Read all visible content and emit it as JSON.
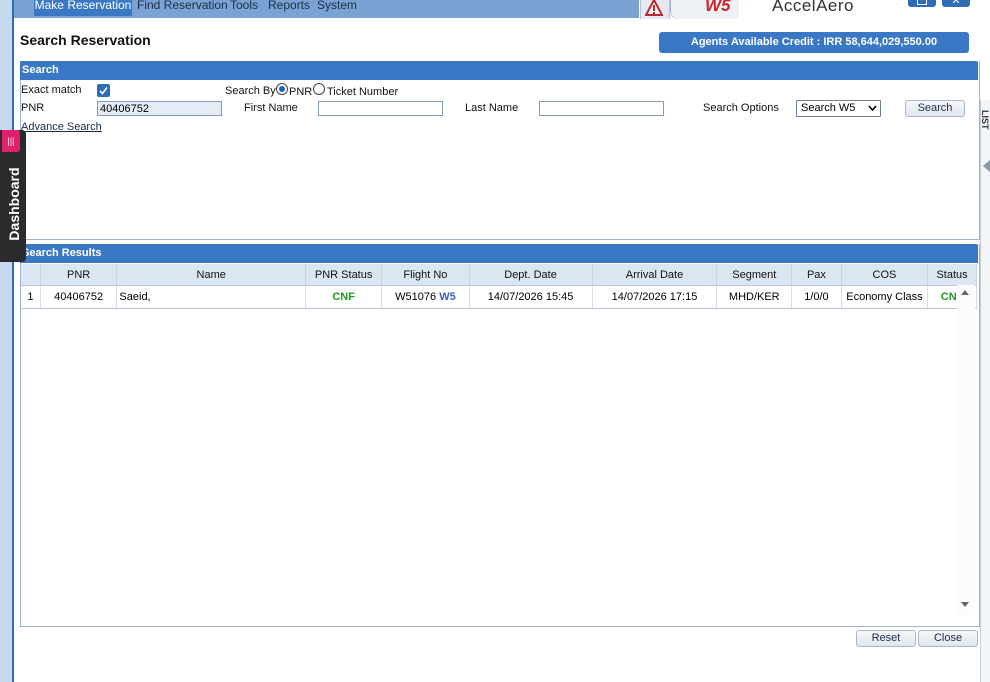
{
  "menu": {
    "items": [
      "Make Reservation",
      "Find Reservation",
      "Tools",
      "Reports",
      "System"
    ]
  },
  "brand": {
    "code": "W5",
    "product": "AccelAero"
  },
  "page_title": "Search Reservation",
  "credit": "Agents Available Credit : IRR 58,644,029,550.00",
  "search": {
    "header": "Search",
    "exact_match_label": "Exact match",
    "exact_match_checked": true,
    "search_by_label": "Search By",
    "search_by_options": [
      "PNR",
      "Ticket Number"
    ],
    "search_by_selected": "PNR",
    "pnr_label": "PNR",
    "pnr_value": "40406752",
    "first_name_label": "First Name",
    "first_name_value": "",
    "last_name_label": "Last Name",
    "last_name_value": "",
    "search_options_label": "Search Options",
    "search_options_value": "Search W5",
    "search_button": "Search",
    "advance_search": "Advance Search"
  },
  "results": {
    "header": "Search Results",
    "columns": [
      "",
      "PNR",
      "Name",
      "PNR Status",
      "Flight No",
      "Dept. Date",
      "Arrival Date",
      "Segment",
      "Pax",
      "COS",
      "Status"
    ],
    "rows": [
      {
        "index": "1",
        "pnr": "40406752",
        "name": "Saeid,",
        "pnr_status": "CNF",
        "flight_no": "W51076",
        "flight_carrier": "W5",
        "dept_date": "14/07/2026 15:45",
        "arrival_date": "14/07/2026 17:15",
        "segment": "MHD/KER",
        "pax": "1/0/0",
        "cos": "Economy Class",
        "status": "CNF"
      }
    ]
  },
  "footer": {
    "reset": "Reset",
    "close": "Close"
  },
  "side_tabs": {
    "dashboard": "Dashboard",
    "pnr_list": "PNR LIST"
  },
  "colors": {
    "accent": "#3a78c6",
    "confirmed": "#1e9a1e",
    "brand_red": "#d2232a",
    "dashboard_pink": "#e0206f"
  },
  "icons": {
    "warning": "warning-icon",
    "checkbox": "checkbox-icon",
    "scroll_up": "scroll-up-icon",
    "scroll_down": "scroll-down-icon"
  }
}
